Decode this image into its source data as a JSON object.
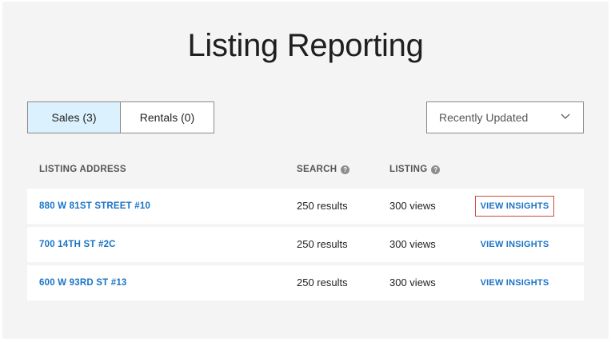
{
  "page": {
    "title": "Listing Reporting"
  },
  "tabs": [
    {
      "label": "Sales (3)",
      "active": true
    },
    {
      "label": "Rentals (0)",
      "active": false
    }
  ],
  "sort": {
    "selected": "Recently Updated",
    "icon": "chevron-down-icon"
  },
  "table": {
    "headers": {
      "address": "LISTING ADDRESS",
      "search": "SEARCH",
      "listing": "LISTING",
      "help_icon": "question-circle-icon",
      "help_glyph": "?"
    },
    "rows": [
      {
        "address": "880 W 81ST STREET #10",
        "search": "250 results",
        "listing": "300 views",
        "action": "VIEW INSIGHTS"
      },
      {
        "address": "700 14TH ST #2C",
        "search": "250 results",
        "listing": "300 views",
        "action": "VIEW INSIGHTS"
      },
      {
        "address": "600 W 93RD ST #13",
        "search": "250 results",
        "listing": "300 views",
        "action": "VIEW INSIGHTS"
      }
    ]
  },
  "colors": {
    "link": "#1a73c6",
    "active_tab_bg": "#dbf1fd",
    "focus_outline": "#d04a3a",
    "panel_bg": "#f4f4f4"
  }
}
